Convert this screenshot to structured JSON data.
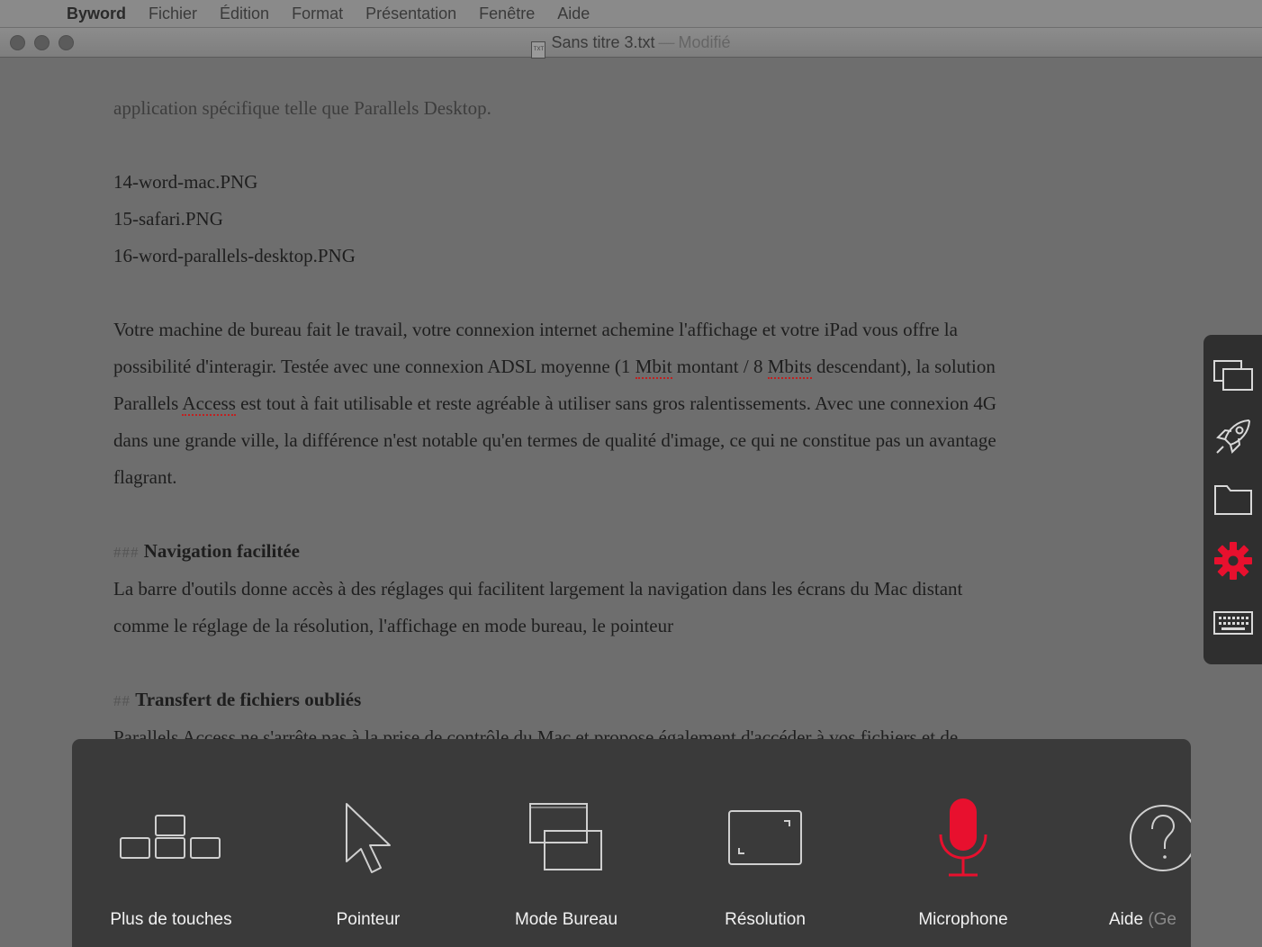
{
  "menubar": {
    "items": [
      "Byword",
      "Fichier",
      "Édition",
      "Format",
      "Présentation",
      "Fenêtre",
      "Aide"
    ]
  },
  "window": {
    "file_icon_text": "TXT",
    "title": "Sans titre 3.txt",
    "separator": "—",
    "status": "Modifié"
  },
  "document": {
    "line_intro": "application spécifique telle que Parallels Desktop.",
    "files": [
      "14-word-mac.PNG",
      "15-safari.PNG",
      "16-word-parallels-desktop.PNG"
    ],
    "para1": {
      "l1": "Votre machine de bureau fait le travail, votre connexion internet achemine l'affichage et votre iPad vous offre la",
      "l2a": "possibilité d'interagir. Testée avec une connexion ADSL moyenne (1 ",
      "l2b": "Mbit",
      "l2c": " montant / 8 ",
      "l2d": "Mbits",
      "l2e": " descendant), la solution",
      "l3a": "Parallels ",
      "l3b": "Access",
      "l3c": " est tout à fait utilisable et reste agréable à utiliser sans gros ralentissements. Avec une connexion 4G",
      "l4": "dans une grande ville, la différence n'est notable qu'en termes de qualité d'image, ce qui ne constitue pas un avantage",
      "l5": "flagrant."
    },
    "section1": {
      "marker": "###",
      "heading": "Navigation facilitée",
      "l1": "La barre d'outils donne accès à des réglages qui facilitent largement la navigation dans les écrans du Mac distant",
      "l2": "comme le réglage de la résolution, l'affichage en mode bureau, le pointeur"
    },
    "section2": {
      "marker": "##",
      "heading": "Transfert de fichiers oubliés",
      "l1": "Parallels Access ne s'arrête pas à la prise de contrôle du Mac et propose également d'accéder à vos fichiers et de"
    }
  },
  "side_toolbar": {
    "items": [
      "windows-icon",
      "rocket-icon",
      "folder-icon",
      "gear-icon",
      "keyboard-icon"
    ],
    "active": "gear-icon",
    "active_color": "#e8102e"
  },
  "tool_panel": {
    "items": [
      {
        "label": "Plus de touches",
        "icon": "keys-icon"
      },
      {
        "label": "Pointeur",
        "icon": "pointer-icon"
      },
      {
        "label": "Mode Bureau",
        "icon": "desktop-mode-icon"
      },
      {
        "label": "Résolution",
        "icon": "resolution-icon"
      },
      {
        "label": "Microphone",
        "icon": "microphone-icon"
      },
      {
        "label": "Aide",
        "label_dim": "(Ge",
        "icon": "help-icon"
      }
    ],
    "accent": "#e8102e"
  }
}
